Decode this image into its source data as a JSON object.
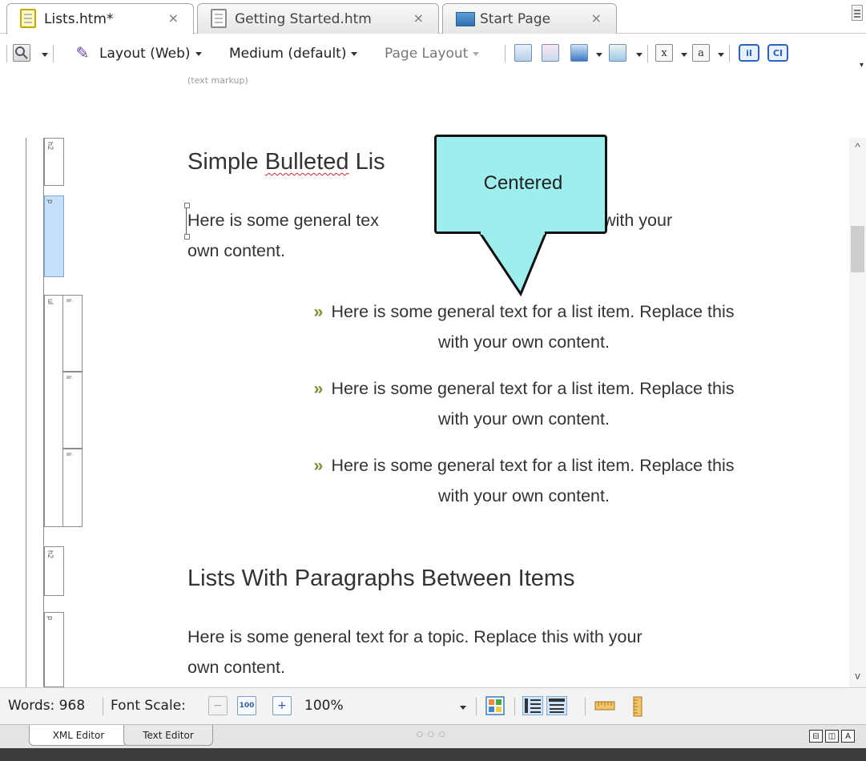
{
  "tabs": [
    {
      "label": "Lists.htm*",
      "active": true
    },
    {
      "label": "Getting Started.htm",
      "active": false
    },
    {
      "label": "Start Page",
      "active": false
    }
  ],
  "tab_close_glyph": "×",
  "toolbar": {
    "layout_label": "Layout (Web)",
    "medium_label": "Medium (default)",
    "page_layout_label": "Page Layout",
    "icons": [
      "magnifier-icon",
      "feather-icon",
      "preview-icon",
      "translate-icon",
      "image-icon",
      "conditions-icon",
      "variable-x-icon",
      "variable-a-icon",
      "insert-i-icon",
      "insert-ci-icon"
    ],
    "ii_label": "iI",
    "ci_label": "CI"
  },
  "text_markup_label": "(text markup)",
  "structure_bar": {
    "tags": [
      "h2",
      "p",
      "ul",
      "li",
      "li",
      "li",
      "h2",
      "p"
    ]
  },
  "document": {
    "heading1_pre": "Simple ",
    "heading1_squiggle": "Bulleted",
    "heading1_post": " Lis",
    "para1_line1_left": "Here is some general tex",
    "para1_line1_right": "ace this with your",
    "para1_line2": "own content.",
    "bullet_glyph": "»",
    "list_items": [
      {
        "line1": "Here is some general text for a list item. Replace this",
        "line2": "with your own content."
      },
      {
        "line1": "Here is some general text for a list item. Replace this",
        "line2": "with your own content."
      },
      {
        "line1": "Here is some general text for a list item. Replace this",
        "line2": "with your own content."
      }
    ],
    "heading2": "Lists With Paragraphs Between Items",
    "para2_line1": "Here is some general text for a topic. Replace this with your",
    "para2_line2": "own content."
  },
  "callout": {
    "text": "Centered",
    "fill": "#9eeeee"
  },
  "statusbar": {
    "words": "Words: 968",
    "font_scale_label": "Font Scale:",
    "zoom_value": "100%",
    "font_scale_reset": "100",
    "font_scale_plus": "+",
    "font_scale_minus": "−"
  },
  "editor_tabs": [
    {
      "label": "XML Editor",
      "active": true
    },
    {
      "label": "Text Editor",
      "active": false
    }
  ],
  "view_buttons": [
    "⊟",
    "◫",
    "A"
  ],
  "colors": {
    "accent": "#2a63c5",
    "bullet": "#7b8d2f",
    "selected_tag": "#c7e0fa"
  }
}
